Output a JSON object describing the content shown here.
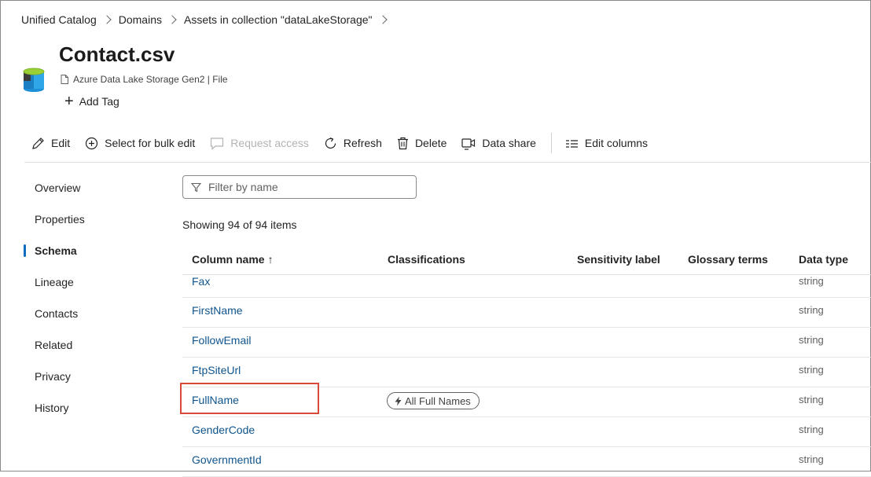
{
  "breadcrumb": [
    "Unified Catalog",
    "Domains",
    "Assets in collection \"dataLakeStorage\""
  ],
  "asset": {
    "title": "Contact.csv",
    "subtitle": "Azure Data Lake Storage Gen2 | File",
    "add_tag_label": "Add Tag"
  },
  "toolbar": {
    "edit": "Edit",
    "bulk_edit": "Select for bulk edit",
    "request_access": "Request access",
    "refresh": "Refresh",
    "delete": "Delete",
    "data_share": "Data share",
    "edit_columns": "Edit columns"
  },
  "nav": {
    "items": [
      "Overview",
      "Properties",
      "Schema",
      "Lineage",
      "Contacts",
      "Related",
      "Privacy",
      "History"
    ],
    "active": "Schema"
  },
  "filter": {
    "placeholder": "Filter by name",
    "value": ""
  },
  "showing_text": "Showing 94 of 94 items",
  "table": {
    "columns": {
      "name": "Column name",
      "sort_indicator": "↑",
      "classifications": "Classifications",
      "sensitivity": "Sensitivity label",
      "glossary": "Glossary terms",
      "data_type": "Data type"
    },
    "rows": [
      {
        "name": "Fax",
        "classification": "",
        "type": "string"
      },
      {
        "name": "FirstName",
        "classification": "",
        "type": "string"
      },
      {
        "name": "FollowEmail",
        "classification": "",
        "type": "string"
      },
      {
        "name": "FtpSiteUrl",
        "classification": "",
        "type": "string"
      },
      {
        "name": "FullName",
        "classification": "All Full Names",
        "type": "string"
      },
      {
        "name": "GenderCode",
        "classification": "",
        "type": "string"
      },
      {
        "name": "GovernmentId",
        "classification": "",
        "type": "string"
      }
    ]
  },
  "colors": {
    "accent": "#0f6cbd",
    "link": "#0f548c",
    "highlight": "#d9493a"
  }
}
